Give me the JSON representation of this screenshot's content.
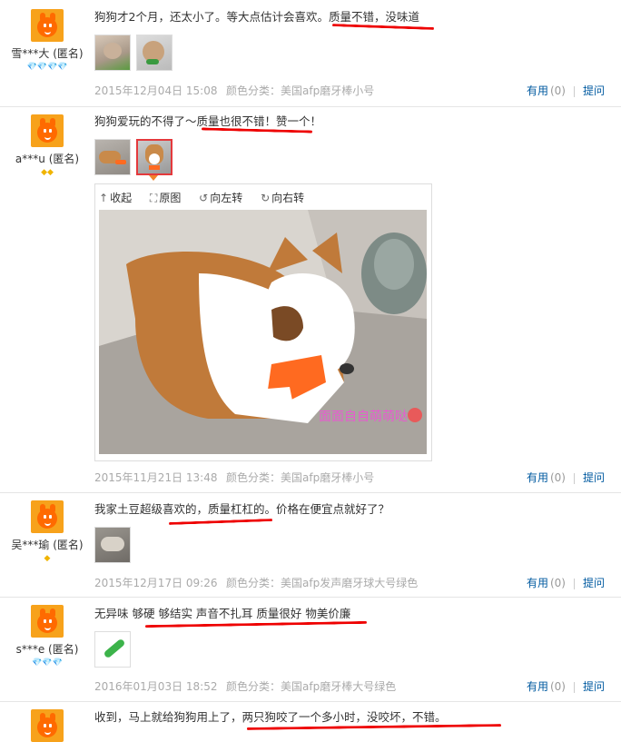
{
  "reviews": [
    {
      "user": "雪***大 (匿名)",
      "badge": "💎💎💎💎",
      "content": "狗狗才2个月，还太小了。等大点估计会喜欢。质量不错，没味道",
      "date": "2015年12月04日 15:08",
      "spec": "颜色分类：美国afp磨牙棒小号",
      "useful_label": "有用",
      "useful_count": "(0)",
      "reply_label": "提问"
    },
    {
      "user": "a***u (匿名)",
      "badge": "◆◆",
      "content": "狗狗爱玩的不得了～质量也很不错！赞一个！",
      "date": "2015年11月21日 13:48",
      "spec": "颜色分类：美国afp磨牙棒小号",
      "useful_label": "有用",
      "useful_count": "(0)",
      "reply_label": "提问"
    },
    {
      "user": "吴***瑜 (匿名)",
      "badge": "◆",
      "content": "我家土豆超级喜欢的，质量杠杠的。价格在便宜点就好了？",
      "date": "2015年12月17日 09:26",
      "spec": "颜色分类：美国afp发声磨牙球大号绿色",
      "useful_label": "有用",
      "useful_count": "(0)",
      "reply_label": "提问"
    },
    {
      "user": "s***e (匿名)",
      "badge": "💎💎💎",
      "content": "无异味 够硬 够结实 声音不扎耳 质量很好 物美价廉",
      "date": "2016年01月03日 18:52",
      "spec": "颜色分类：美国afp磨牙棒大号绿色",
      "useful_label": "有用",
      "useful_count": "(0)",
      "reply_label": "提问"
    },
    {
      "content": "收到，马上就给狗狗用上了，两只狗咬了一个多小时，没咬坏，不错。"
    }
  ],
  "viewer": {
    "collapse": "收起",
    "original": "原图",
    "rotate_left": "向左转",
    "rotate_right": "向右转",
    "collapse_icon": "up-arrow-icon",
    "original_icon": "expand-icon",
    "rotate_left_icon": "rotate-left-icon",
    "rotate_right_icon": "rotate-right-icon",
    "watermark": "面面自自萌萌哒"
  },
  "colors": {
    "link": "#005aa0",
    "meta": "#aaaaaa",
    "underline": "#e00000",
    "avatar": "#ff6a00"
  }
}
